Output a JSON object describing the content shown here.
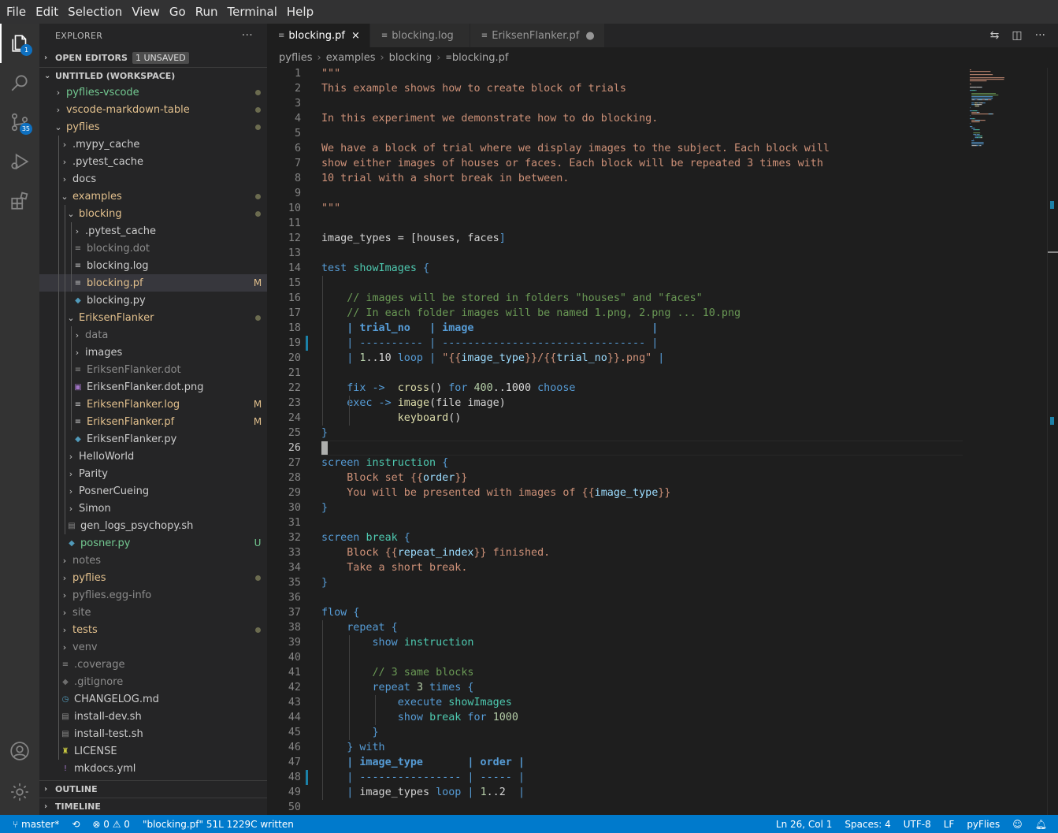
{
  "menu": [
    "File",
    "Edit",
    "Selection",
    "View",
    "Go",
    "Run",
    "Terminal",
    "Help"
  ],
  "activity": {
    "explorer_badge": "1",
    "scm_badge": "35"
  },
  "sidebar": {
    "title": "EXPLORER",
    "more": "···",
    "open_editors": "OPEN EDITORS",
    "unsaved_badge": "1 UNSAVED",
    "workspace": "UNTITLED (WORKSPACE)",
    "outline": "OUTLINE",
    "timeline": "TIMELINE",
    "tree": [
      {
        "label": "pyflies-vscode",
        "depth": 0,
        "kind": "folder",
        "open": false,
        "color": "#73c991",
        "status": "dot"
      },
      {
        "label": "vscode-markdown-table",
        "depth": 0,
        "kind": "folder",
        "open": false,
        "color": "#e2c08d",
        "status": "dot"
      },
      {
        "label": "pyflies",
        "depth": 0,
        "kind": "folder",
        "open": true,
        "color": "#e2c08d",
        "status": "dot"
      },
      {
        "label": ".mypy_cache",
        "depth": 1,
        "kind": "folder",
        "open": false,
        "color": "#cccccc",
        "status": ""
      },
      {
        "label": ".pytest_cache",
        "depth": 1,
        "kind": "folder",
        "open": false,
        "color": "#cccccc",
        "status": ""
      },
      {
        "label": "docs",
        "depth": 1,
        "kind": "folder",
        "open": false,
        "color": "#cccccc",
        "status": ""
      },
      {
        "label": "examples",
        "depth": 1,
        "kind": "folder",
        "open": true,
        "color": "#e2c08d",
        "status": "dot"
      },
      {
        "label": "blocking",
        "depth": 2,
        "kind": "folder",
        "open": true,
        "color": "#e2c08d",
        "status": "dot"
      },
      {
        "label": ".pytest_cache",
        "depth": 3,
        "kind": "folder",
        "open": false,
        "color": "#cccccc",
        "status": ""
      },
      {
        "label": "blocking.dot",
        "depth": 3,
        "kind": "file",
        "icon": "≡",
        "iconColor": "#8b8b8b",
        "color": "#8c8c8c",
        "status": ""
      },
      {
        "label": "blocking.log",
        "depth": 3,
        "kind": "file",
        "icon": "≡",
        "iconColor": "#c5c5c5",
        "color": "#cccccc",
        "status": ""
      },
      {
        "label": "blocking.pf",
        "depth": 3,
        "kind": "file",
        "icon": "≡",
        "iconColor": "#c5c5c5",
        "color": "#e2c08d",
        "status": "M",
        "selected": true
      },
      {
        "label": "blocking.py",
        "depth": 3,
        "kind": "file",
        "icon": "◆",
        "iconColor": "#519aba",
        "color": "#cccccc",
        "status": ""
      },
      {
        "label": "EriksenFlanker",
        "depth": 2,
        "kind": "folder",
        "open": true,
        "color": "#e2c08d",
        "status": "dot"
      },
      {
        "label": "data",
        "depth": 3,
        "kind": "folder",
        "open": false,
        "color": "#8c8c8c",
        "status": ""
      },
      {
        "label": "images",
        "depth": 3,
        "kind": "folder",
        "open": false,
        "color": "#cccccc",
        "status": ""
      },
      {
        "label": "EriksenFlanker.dot",
        "depth": 3,
        "kind": "file",
        "icon": "≡",
        "iconColor": "#8b8b8b",
        "color": "#8c8c8c",
        "status": ""
      },
      {
        "label": "EriksenFlanker.dot.png",
        "depth": 3,
        "kind": "file",
        "icon": "▣",
        "iconColor": "#a074c4",
        "color": "#cccccc",
        "status": ""
      },
      {
        "label": "EriksenFlanker.log",
        "depth": 3,
        "kind": "file",
        "icon": "≡",
        "iconColor": "#c5c5c5",
        "color": "#e2c08d",
        "status": "M"
      },
      {
        "label": "EriksenFlanker.pf",
        "depth": 3,
        "kind": "file",
        "icon": "≡",
        "iconColor": "#c5c5c5",
        "color": "#e2c08d",
        "status": "M"
      },
      {
        "label": "EriksenFlanker.py",
        "depth": 3,
        "kind": "file",
        "icon": "◆",
        "iconColor": "#519aba",
        "color": "#cccccc",
        "status": ""
      },
      {
        "label": "HelloWorld",
        "depth": 2,
        "kind": "folder",
        "open": false,
        "color": "#cccccc",
        "status": ""
      },
      {
        "label": "Parity",
        "depth": 2,
        "kind": "folder",
        "open": false,
        "color": "#cccccc",
        "status": ""
      },
      {
        "label": "PosnerCueing",
        "depth": 2,
        "kind": "folder",
        "open": false,
        "color": "#cccccc",
        "status": ""
      },
      {
        "label": "Simon",
        "depth": 2,
        "kind": "folder",
        "open": false,
        "color": "#cccccc",
        "status": ""
      },
      {
        "label": "gen_logs_psychopy.sh",
        "depth": 2,
        "kind": "file",
        "icon": "▤",
        "iconColor": "#8b8b8b",
        "color": "#cccccc",
        "status": ""
      },
      {
        "label": "posner.py",
        "depth": 2,
        "kind": "file",
        "icon": "◆",
        "iconColor": "#519aba",
        "color": "#73c991",
        "status": "U"
      },
      {
        "label": "notes",
        "depth": 1,
        "kind": "folder",
        "open": false,
        "color": "#8c8c8c",
        "status": ""
      },
      {
        "label": "pyflies",
        "depth": 1,
        "kind": "folder",
        "open": false,
        "color": "#e2c08d",
        "status": "dot"
      },
      {
        "label": "pyflies.egg-info",
        "depth": 1,
        "kind": "folder",
        "open": false,
        "color": "#8c8c8c",
        "status": ""
      },
      {
        "label": "site",
        "depth": 1,
        "kind": "folder",
        "open": false,
        "color": "#8c8c8c",
        "status": ""
      },
      {
        "label": "tests",
        "depth": 1,
        "kind": "folder",
        "open": false,
        "color": "#e2c08d",
        "status": "dot"
      },
      {
        "label": "venv",
        "depth": 1,
        "kind": "folder",
        "open": false,
        "color": "#8c8c8c",
        "status": ""
      },
      {
        "label": ".coverage",
        "depth": 1,
        "kind": "file",
        "icon": "≡",
        "iconColor": "#8b8b8b",
        "color": "#8c8c8c",
        "status": ""
      },
      {
        "label": ".gitignore",
        "depth": 1,
        "kind": "file",
        "icon": "◆",
        "iconColor": "#6d6d6d",
        "color": "#8c8c8c",
        "status": ""
      },
      {
        "label": "CHANGELOG.md",
        "depth": 1,
        "kind": "file",
        "icon": "◷",
        "iconColor": "#519aba",
        "color": "#cccccc",
        "status": ""
      },
      {
        "label": "install-dev.sh",
        "depth": 1,
        "kind": "file",
        "icon": "▤",
        "iconColor": "#8b8b8b",
        "color": "#cccccc",
        "status": ""
      },
      {
        "label": "install-test.sh",
        "depth": 1,
        "kind": "file",
        "icon": "▤",
        "iconColor": "#8b8b8b",
        "color": "#cccccc",
        "status": ""
      },
      {
        "label": "LICENSE",
        "depth": 1,
        "kind": "file",
        "icon": "♜",
        "iconColor": "#cbcb41",
        "color": "#cccccc",
        "status": ""
      },
      {
        "label": "mkdocs.yml",
        "depth": 1,
        "kind": "file",
        "icon": "!",
        "iconColor": "#a074c4",
        "color": "#cccccc",
        "status": ""
      }
    ]
  },
  "tabs": [
    {
      "label": "blocking.pf",
      "active": true,
      "close": "×"
    },
    {
      "label": "blocking.log",
      "active": false,
      "close": ""
    },
    {
      "label": "EriksenFlanker.pf",
      "active": false,
      "close": "●"
    }
  ],
  "breadcrumbs": [
    "pyflies",
    "examples",
    "blocking",
    "blocking.pf"
  ],
  "editor": {
    "cursor_line": 26,
    "modified_lines": [
      19,
      48
    ],
    "lines": [
      [
        [
          "s",
          "\"\"\""
        ]
      ],
      [
        [
          "s",
          "This example shows how to create block of trials"
        ]
      ],
      [],
      [
        [
          "s",
          "In this experiment we demonstrate how to do blocking."
        ]
      ],
      [],
      [
        [
          "s",
          "We have a block of trial where we display images to the subject. Each block will"
        ]
      ],
      [
        [
          "s",
          "show either images of houses or faces. Each block will be repeated 3 times with"
        ]
      ],
      [
        [
          "s",
          "10 trial with a short break in between."
        ]
      ],
      [],
      [
        [
          "s",
          "\"\"\""
        ]
      ],
      [],
      [
        [
          "",
          "image_types = ["
        ],
        [
          "",
          "houses, faces"
        ],
        [
          "k",
          "]"
        ]
      ],
      [],
      [
        [
          "k",
          "test "
        ],
        [
          "t",
          "showImages"
        ],
        [
          "k",
          " {"
        ]
      ],
      [],
      [
        [
          "c",
          "    // images will be stored in folders \"houses\" and \"faces\""
        ]
      ],
      [
        [
          "c",
          "    // In each folder images will be named 1.png, 2.png ... 10.png"
        ]
      ],
      [
        [
          "h",
          "    | trial_no   | image                            |"
        ]
      ],
      [
        [
          "k",
          "    | ---------- | -------------------------------- |"
        ]
      ],
      [
        [
          "k",
          "    | "
        ],
        [
          "n",
          "1"
        ],
        [
          "",
          "..10 "
        ],
        [
          "k",
          "loop"
        ],
        [
          "k",
          " | "
        ],
        [
          "s",
          "\"{{"
        ],
        [
          "v",
          "image_type"
        ],
        [
          "s",
          "}}/{{"
        ],
        [
          "v",
          "trial_no"
        ],
        [
          "s",
          "}}.png\""
        ],
        [
          "k",
          " |"
        ]
      ],
      [],
      [
        [
          "k",
          "    fix -> "
        ],
        [
          "",
          " "
        ],
        [
          "f",
          "cross"
        ],
        [
          "",
          "() "
        ],
        [
          "k",
          "for "
        ],
        [
          "n",
          "400"
        ],
        [
          "",
          "..1000 "
        ],
        [
          "k",
          "choose"
        ]
      ],
      [
        [
          "k",
          "    exec -> "
        ],
        [
          "f",
          "image"
        ],
        [
          "",
          "(file image)"
        ]
      ],
      [
        [
          "",
          "            "
        ],
        [
          "f",
          "keyboard"
        ],
        [
          "",
          "()"
        ]
      ],
      [
        [
          "k",
          "}"
        ]
      ],
      [],
      [
        [
          "k",
          "screen "
        ],
        [
          "t",
          "instruction"
        ],
        [
          "k",
          " {"
        ]
      ],
      [
        [
          "s",
          "    Block set {{"
        ],
        [
          "v",
          "order"
        ],
        [
          "s",
          "}}"
        ]
      ],
      [
        [
          "s",
          "    You will be presented with images of {{"
        ],
        [
          "v",
          "image_type"
        ],
        [
          "s",
          "}}"
        ]
      ],
      [
        [
          "k",
          "}"
        ]
      ],
      [],
      [
        [
          "k",
          "screen "
        ],
        [
          "t",
          "break"
        ],
        [
          "k",
          " {"
        ]
      ],
      [
        [
          "s",
          "    Block {{"
        ],
        [
          "v",
          "repeat_index"
        ],
        [
          "s",
          "}} finished."
        ]
      ],
      [
        [
          "s",
          "    Take a short break."
        ]
      ],
      [
        [
          "k",
          "}"
        ]
      ],
      [],
      [
        [
          "k",
          "flow {"
        ]
      ],
      [
        [
          "k",
          "    repeat {"
        ]
      ],
      [
        [
          "k",
          "        show "
        ],
        [
          "t",
          "instruction"
        ]
      ],
      [],
      [
        [
          "c",
          "        // 3 same blocks"
        ]
      ],
      [
        [
          "k",
          "        repeat "
        ],
        [
          "n",
          "3"
        ],
        [
          "k",
          " times {"
        ]
      ],
      [
        [
          "k",
          "            execute "
        ],
        [
          "t",
          "showImages"
        ]
      ],
      [
        [
          "k",
          "            show "
        ],
        [
          "t",
          "break"
        ],
        [
          "k",
          " for "
        ],
        [
          "n",
          "1000"
        ]
      ],
      [
        [
          "k",
          "        }"
        ]
      ],
      [
        [
          "k",
          "    } with"
        ]
      ],
      [
        [
          "h",
          "    | image_type       | order |"
        ]
      ],
      [
        [
          "k",
          "    | ---------------- | ----- |"
        ]
      ],
      [
        [
          "k",
          "    | "
        ],
        [
          "",
          "image_types "
        ],
        [
          "k",
          "loop"
        ],
        [
          "k",
          " | "
        ],
        [
          "n",
          "1"
        ],
        [
          "",
          "..2  "
        ],
        [
          "k",
          "|"
        ]
      ],
      []
    ]
  },
  "statusbar": {
    "branch": "master*",
    "sync": "⟲",
    "problems": "⊗ 0 ⚠ 0",
    "message": "\"blocking.pf\" 51L 1229C written",
    "position": "Ln 26, Col 1",
    "spaces": "Spaces: 4",
    "encoding": "UTF-8",
    "eol": "LF",
    "language": "pyFlies"
  }
}
